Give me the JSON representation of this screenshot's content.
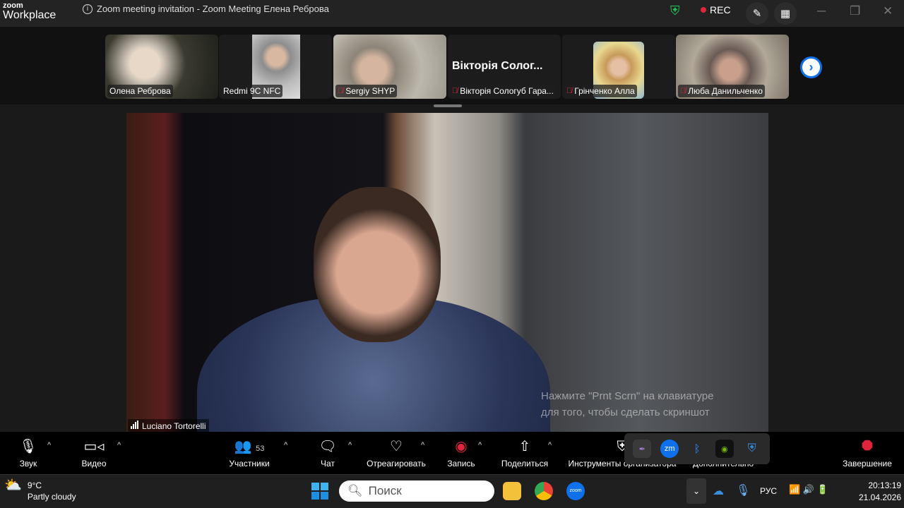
{
  "window": {
    "logo_small": "zoom",
    "logo_big": "Workplace",
    "title": "Zoom meeting invitation - Zoom Meeting Елена Реброва",
    "rec_label": "REC"
  },
  "participants": [
    {
      "name": "Олена Реброва",
      "muted": false
    },
    {
      "name": "Redmi 9C NFC",
      "muted": false
    },
    {
      "name": "Sergiy SHYP",
      "muted": true
    },
    {
      "name": "Вікторія Сологуб Гара...",
      "muted": true,
      "display_title": "Вікторія Солог..."
    },
    {
      "name": "Грінченко Алла",
      "muted": true
    },
    {
      "name": "Люба Данильченко",
      "muted": true
    }
  ],
  "speaker": {
    "name": "Luciano Tortorelli"
  },
  "watermark": {
    "line1": "Нажмите \"Prnt Scrn\" на клавиатуре",
    "line2": "для того, чтобы сделать скриншот"
  },
  "toolbar": {
    "audio": "Звук",
    "video": "Видео",
    "participants": "Участники",
    "participants_count": "53",
    "chat": "Чат",
    "react": "Отреагировать",
    "record": "Запись",
    "share": "Поделиться",
    "host_tools": "Инструменты организатора",
    "more": "Дополнительно",
    "end": "Завершение"
  },
  "taskbar": {
    "temp": "9°C",
    "weather": "Partly cloudy",
    "search_placeholder": "Поиск",
    "lang": "РУС",
    "time": "20:13:19",
    "date": "21.04.2026"
  },
  "colors": {
    "accent": "#0e71eb",
    "red": "#e0243b",
    "shield": "#22c55e"
  }
}
